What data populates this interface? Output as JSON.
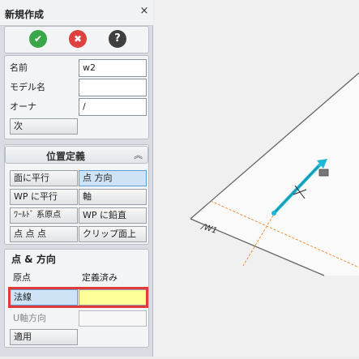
{
  "dialog": {
    "title": "新規作成",
    "close_glyph": "×",
    "actions": {
      "ok_glyph": "✔",
      "cancel_glyph": "✖",
      "help_glyph": "?"
    }
  },
  "basic": {
    "name_label": "名前",
    "name_value": "w2",
    "model_label": "モデル名",
    "model_value": "",
    "owner_label": "オーナ",
    "owner_value": "/",
    "next_label": "次"
  },
  "position": {
    "header": "位置定義",
    "collapse_glyph": "︽",
    "buttons": [
      {
        "label": "面に平行"
      },
      {
        "label": "点 方向"
      },
      {
        "label": "WP に平行"
      },
      {
        "label": "軸"
      },
      {
        "label": "ﾜｰﾙﾄﾞ 系原点"
      },
      {
        "label": "WP に鉛直"
      },
      {
        "label": "点 点 点"
      },
      {
        "label": "クリップ面上"
      }
    ]
  },
  "point_direction": {
    "header": "点 & 方向",
    "origin_label": "原点",
    "origin_value": "定義済み",
    "normal_label": "法線",
    "normal_value": "",
    "u_axis_label": "U軸方向",
    "u_axis_value": "",
    "apply_label": "適用"
  },
  "viewport": {
    "plane_label": "/W1"
  },
  "colors": {
    "ok": "#3aa64a",
    "cancel": "#e0403f",
    "help": "#3f3f3f",
    "selected": "#cfe3f6",
    "highlight_field": "#ffff99",
    "highlight_border": "#e03a3a",
    "axis_orange": "#f0903a",
    "manipulator": "#1fb7d6"
  }
}
